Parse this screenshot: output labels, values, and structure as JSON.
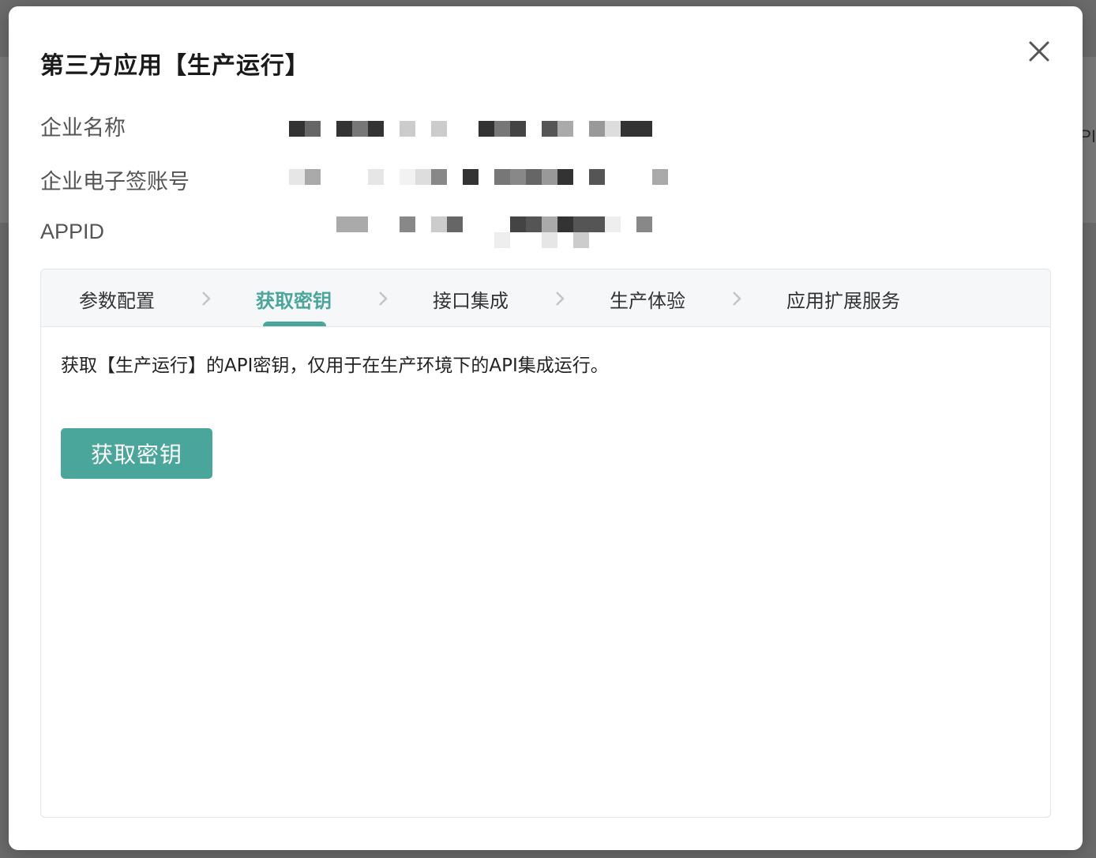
{
  "background": {
    "peek_text": "API"
  },
  "modal": {
    "title": "第三方应用【生产运行】",
    "close_icon": "close-icon"
  },
  "info": {
    "company_name_label": "企业名称",
    "esign_account_label": "企业电子签账号",
    "appid_label": "APPID"
  },
  "steps": [
    {
      "label": "参数配置",
      "active": false
    },
    {
      "label": "获取密钥",
      "active": true
    },
    {
      "label": "接口集成",
      "active": false
    },
    {
      "label": "生产体验",
      "active": false
    },
    {
      "label": "应用扩展服务",
      "active": false
    }
  ],
  "panel": {
    "description": "获取【生产运行】的API密钥，仅用于在生产环境下的API集成运行。",
    "button_label": "获取密钥"
  },
  "colors": {
    "accent": "#4aa69b"
  }
}
